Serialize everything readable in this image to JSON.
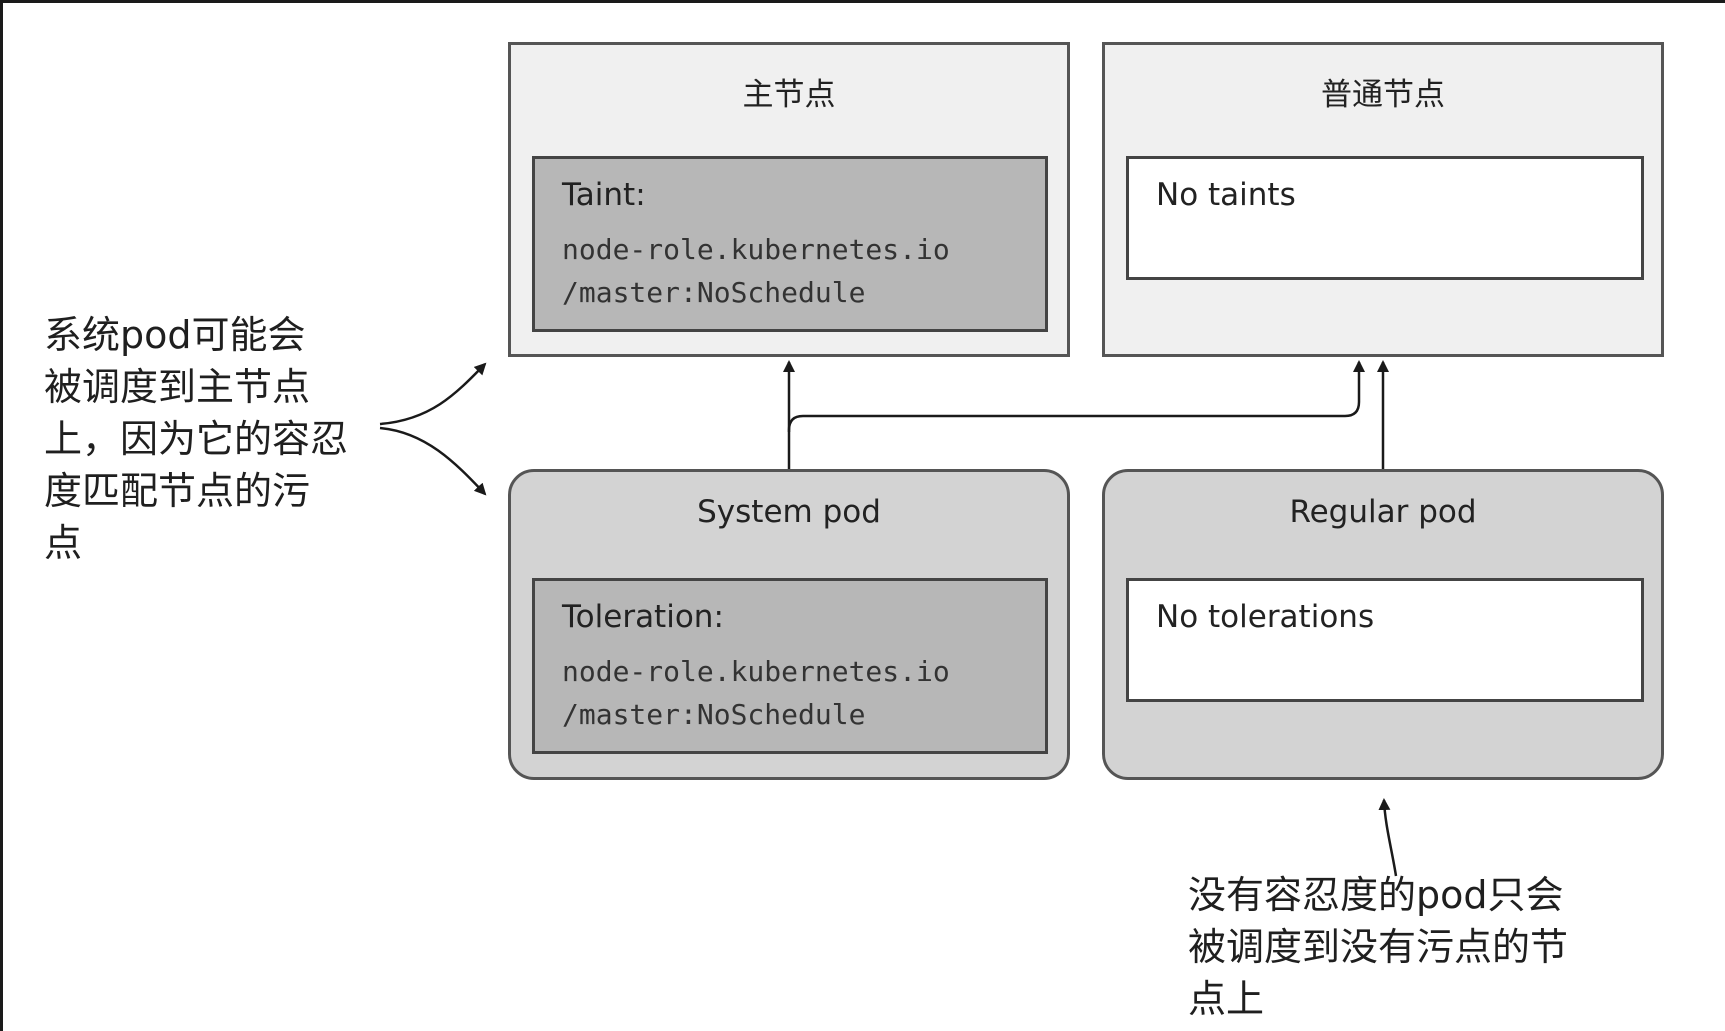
{
  "master_node": {
    "title": "主节点",
    "taint_label": "Taint:",
    "taint_line1": "node-role.kubernetes.io",
    "taint_line2": "/master:NoSchedule"
  },
  "regular_node": {
    "title": "普通节点",
    "taint_label": "No taints"
  },
  "system_pod": {
    "title": "System pod",
    "toleration_label": "Toleration:",
    "toleration_line1": "node-role.kubernetes.io",
    "toleration_line2": "/master:NoSchedule"
  },
  "regular_pod": {
    "title": "Regular pod",
    "toleration_label": "No tolerations"
  },
  "annotations": {
    "left": "系统pod可能会\n被调度到主节点\n上，因为它的容忍\n度匹配节点的污\n点",
    "bottom": "没有容忍度的pod只会\n被调度到没有污点的节\n点上"
  }
}
